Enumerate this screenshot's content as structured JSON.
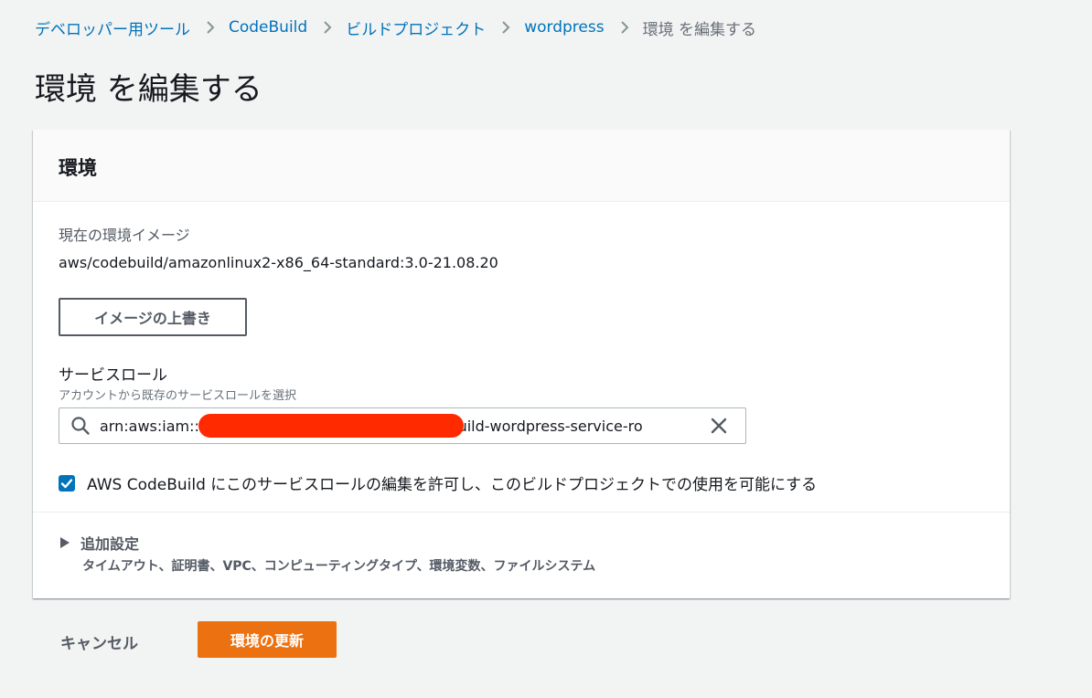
{
  "breadcrumb": {
    "items": [
      "デベロッパー用ツール",
      "CodeBuild",
      "ビルドプロジェクト",
      "wordpress"
    ],
    "current": "環境 を編集する"
  },
  "page": {
    "title": "環境 を編集する"
  },
  "panel": {
    "title": "環境",
    "current_image_label": "現在の環境イメージ",
    "current_image_value": "aws/codebuild/amazonlinux2-x86_64-standard:3.0-21.08.20",
    "override_button": "イメージの上書き",
    "service_role": {
      "label": "サービスロール",
      "description": "アカウントから既存のサービスロールを選択",
      "value": "arn:aws:iam::                                              codebuild-wordpress-service-ro"
    },
    "permission_checkbox": {
      "checked": true,
      "label": "AWS CodeBuild にこのサービスロールの編集を許可し、このビルドプロジェクトでの使用を可能にする"
    },
    "additional_settings": {
      "title": "追加設定",
      "description": "タイムアウト、証明書、VPC、コンピューティングタイプ、環境変数、ファイルシステム"
    }
  },
  "actions": {
    "cancel": "キャンセル",
    "update": "環境の更新"
  },
  "colors": {
    "link": "#0073bb",
    "primary_button": "#ec7211",
    "redaction": "#ff2a00",
    "background": "#f2f3f3"
  }
}
